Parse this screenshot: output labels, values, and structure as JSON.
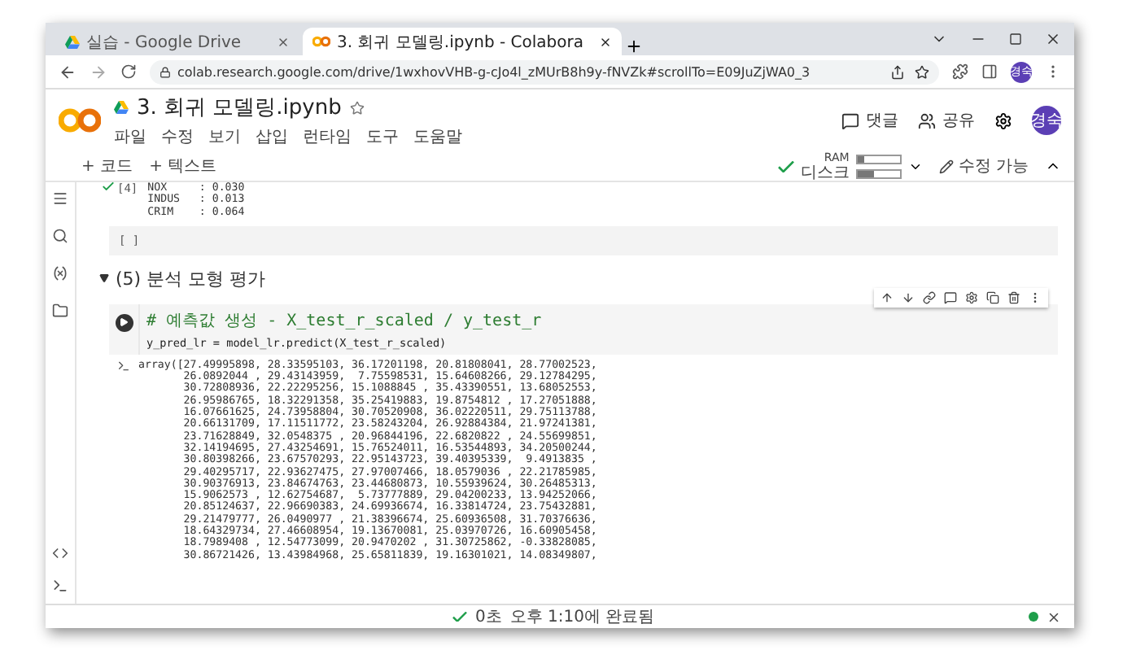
{
  "browser": {
    "tabs": [
      {
        "title": "실습 - Google Drive",
        "kind": "drive",
        "selected": false
      },
      {
        "title": "3. 회귀 모델링.ipynb - Colabora",
        "kind": "colab",
        "selected": true
      }
    ],
    "url": "colab.research.google.com/drive/1wxhovVHB-g-cJo4l_zMUrB8h9y-fNVZk#scrollTo=E09JuZjWA0_3",
    "profile": "경숙"
  },
  "notebook": {
    "title": "3. 회귀 모델링.ipynb",
    "menu": [
      "파일",
      "수정",
      "보기",
      "삽입",
      "런타임",
      "도구",
      "도움말"
    ],
    "actions": [
      {
        "kind": "comment",
        "label": "댓글"
      },
      {
        "kind": "share",
        "label": "공유"
      }
    ],
    "avatar": "경숙",
    "toolbar": {
      "add": [
        "+ 코드",
        "+ 텍스트"
      ],
      "ram": {
        "label": "RAM",
        "level": 0.15
      },
      "disk": {
        "label": "디스크",
        "level": 0.4
      },
      "edit": "수정 가능"
    }
  },
  "cells": {
    "previous_output": {
      "count": "[4]",
      "lines": [
        "NOX     : 0.030",
        "INDUS   : 0.013",
        "CRIM    : 0.064"
      ]
    },
    "empty_cell": "[ ]",
    "section": {
      "title": "(5) 분석 모형 평가",
      "expanded": true
    },
    "code": {
      "comment": "# 예측값 생성 - X_test_r_scaled / y_test_r",
      "line": "y_pred_lr = model_lr.predict(X_test_r_scaled)"
    },
    "output": [
      "array([27.49995898, 28.33595103, 36.17201198, 20.81808041, 28.77002523,",
      "       26.0892044 , 29.43143959,  7.75598531, 15.64608266, 29.12784295,",
      "       30.72808936, 22.22295256, 15.1088845 , 35.43390551, 13.68052553,",
      "       26.95986765, 18.32291358, 35.25419883, 19.8754812 , 17.27051888,",
      "       16.07661625, 24.73958804, 30.70520908, 36.02220511, 29.75113788,",
      "       20.66131709, 17.11511772, 23.58243204, 26.92884384, 21.97241381,",
      "       23.71628849, 32.0548375 , 20.96844196, 22.6820822 , 24.55699851,",
      "       32.14194695, 27.43254691, 15.76524011, 16.53544893, 34.20500244,",
      "       30.80398266, 23.67570293, 22.95143723, 39.40395339,  9.4913835 ,",
      "       29.40295717, 22.93627475, 27.97007466, 18.0579036 , 22.21785985,",
      "       30.90376913, 23.84674763, 23.44680873, 10.55939624, 30.26485313,",
      "       15.9062573 , 12.62754687,  5.73777889, 29.04200233, 13.94252066,",
      "       20.85124637, 22.96690383, 24.69936674, 16.33814724, 23.75432881,",
      "       29.21479777, 26.0490977 , 21.38396674, 25.60936508, 31.70376636,",
      "       18.64329734, 27.46608954, 19.13670081, 25.03970726, 16.60905458,",
      "       18.7989408 , 12.54773099, 20.9470202 , 31.30725862, -0.33828085,",
      "       30.86721426, 13.43984968, 25.65811839, 19.16301021, 14.08349807,"
    ]
  },
  "status": {
    "duration": "0초",
    "message": "오후 1:10에 완료됨",
    "connected": true
  }
}
